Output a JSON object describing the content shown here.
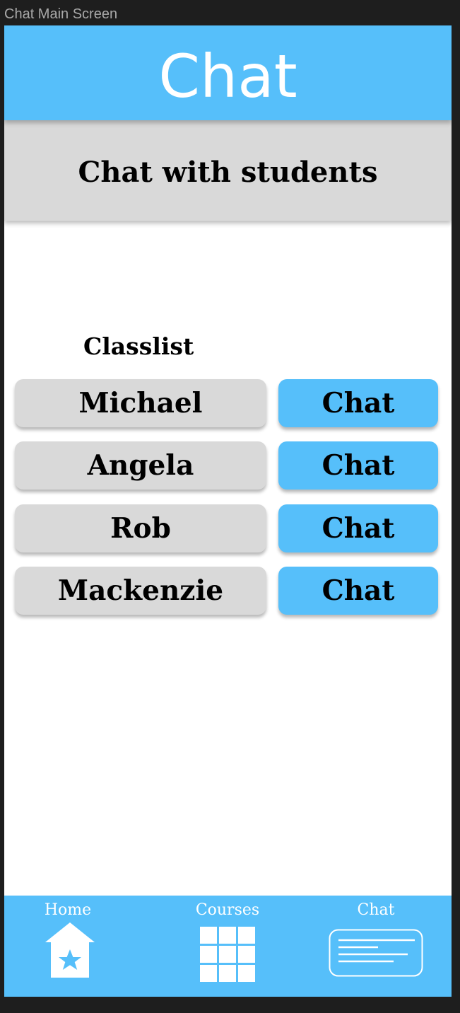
{
  "frame": {
    "title": "Chat Main Screen"
  },
  "header": {
    "title": "Chat"
  },
  "subheader": {
    "title": "Chat with students"
  },
  "classlist": {
    "label": "Classlist",
    "students": [
      {
        "name": "Michael",
        "action": "Chat"
      },
      {
        "name": "Angela",
        "action": "Chat"
      },
      {
        "name": "Rob",
        "action": "Chat"
      },
      {
        "name": "Mackenzie",
        "action": "Chat"
      }
    ]
  },
  "tabbar": {
    "tabs": [
      {
        "label": "Home",
        "icon": "home-star-icon"
      },
      {
        "label": "Courses",
        "icon": "grid-icon"
      },
      {
        "label": "Chat",
        "icon": "chat-message-icon"
      }
    ]
  },
  "colors": {
    "accent": "#56bffa",
    "panel": "#d9d9d9",
    "background": "#ffffff",
    "frame": "#1e1e1e"
  }
}
